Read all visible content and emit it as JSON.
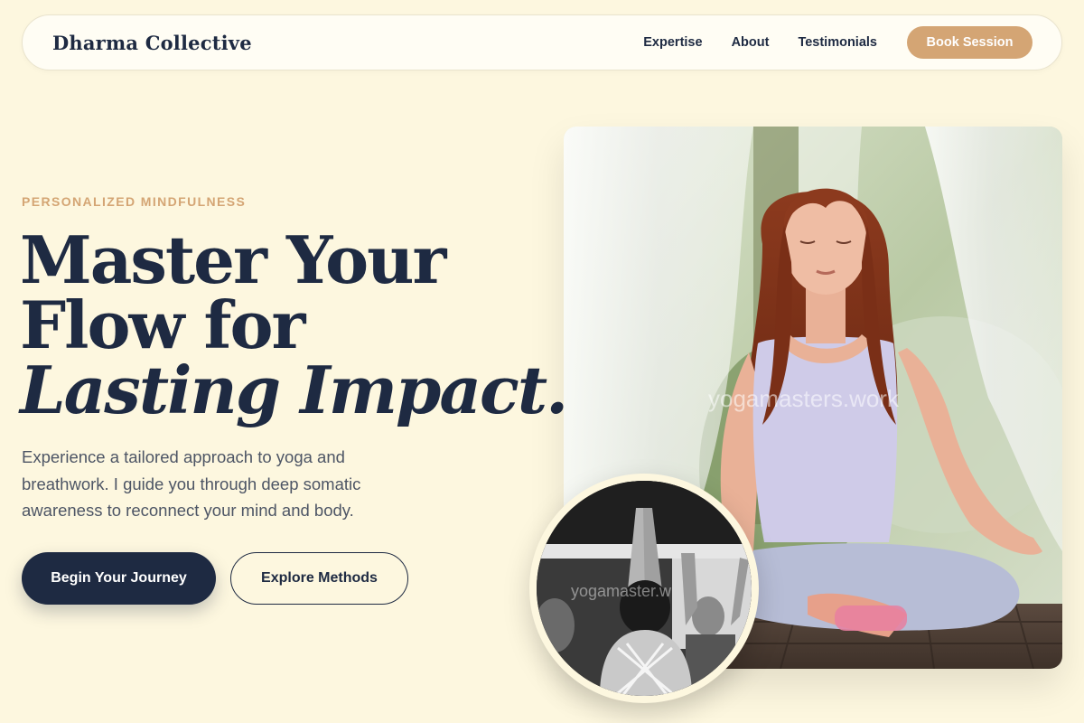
{
  "header": {
    "brand": "Dharma Collective",
    "nav": [
      "Expertise",
      "About",
      "Testimonials"
    ],
    "cta": "Book Session"
  },
  "hero": {
    "eyebrow": "PERSONALIZED MINDFULNESS",
    "headline_line1": "Master Your",
    "headline_line2": "Flow for",
    "headline_line3": "Lasting Impact.",
    "description": "Experience a tailored approach to yoga and breathwork. I guide you through deep somatic awareness to reconnect your mind and body.",
    "primary_button": "Begin Your Journey",
    "secondary_button": "Explore Methods"
  },
  "images": {
    "main_watermark": "yogamasters.work",
    "circle_watermark": "yogamaster.w"
  },
  "colors": {
    "background": "#fdf7df",
    "navy": "#1e2a42",
    "accent": "#d4a574"
  }
}
